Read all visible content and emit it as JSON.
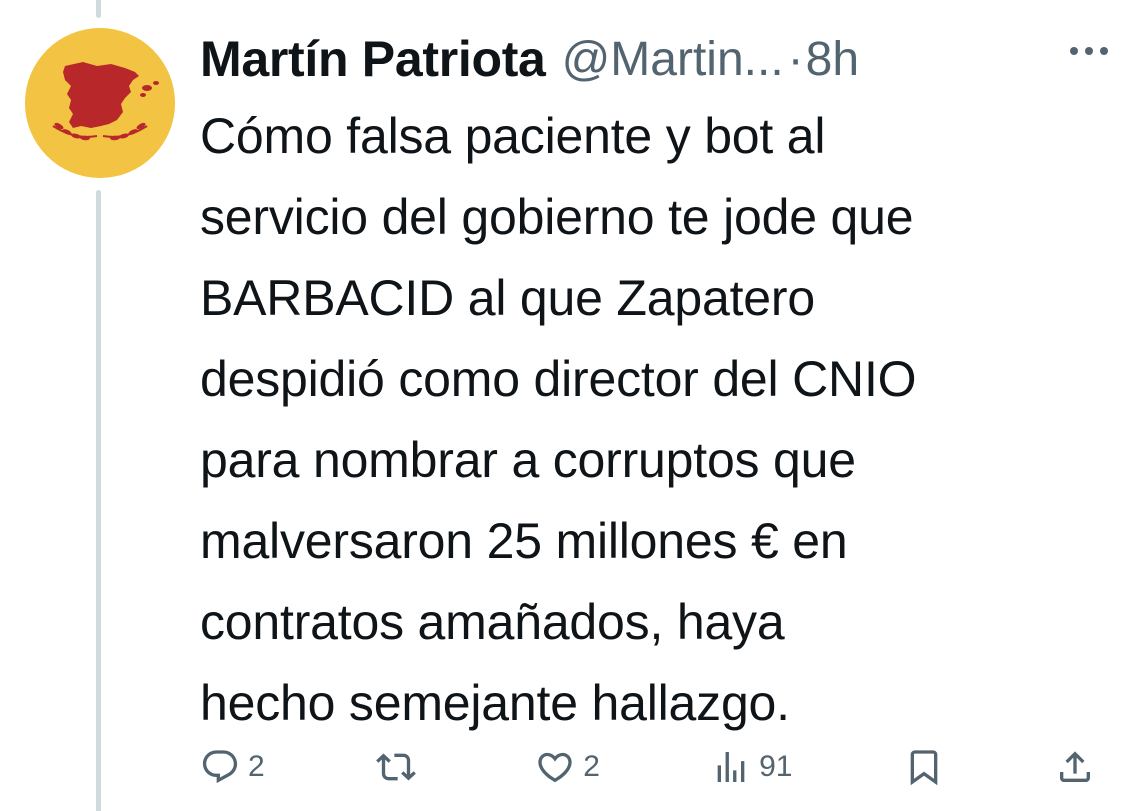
{
  "tweet": {
    "author_name": "Martín Patriota",
    "author_handle": "@Martin...",
    "separator": "·",
    "time": "8h",
    "more_icon": "more-dots-icon",
    "text_lines": [
      "Cómo falsa paciente y bot al",
      "servicio del gobierno te jode que",
      "BARBACID al que Zapatero",
      "despidió como director del CNIO",
      "para nombrar a corruptos que",
      "malversaron 25 millones € en",
      "contratos amañados, haya",
      "hecho semejante hallazgo."
    ]
  },
  "avatar": {
    "background_color": "#f3c443",
    "map_color": "#b8282a",
    "laurel_color": "#b8282a"
  },
  "actions": {
    "replies": {
      "icon": "reply-icon",
      "count": "2"
    },
    "retweets": {
      "icon": "retweet-icon",
      "count": ""
    },
    "likes": {
      "icon": "heart-icon",
      "count": "2"
    },
    "views": {
      "icon": "views-icon",
      "count": "91"
    },
    "bookmark": {
      "icon": "bookmark-icon"
    },
    "share": {
      "icon": "share-icon"
    }
  },
  "colors": {
    "text_primary": "#0f1419",
    "text_secondary": "#536471",
    "thread_line": "#cfd9de"
  }
}
